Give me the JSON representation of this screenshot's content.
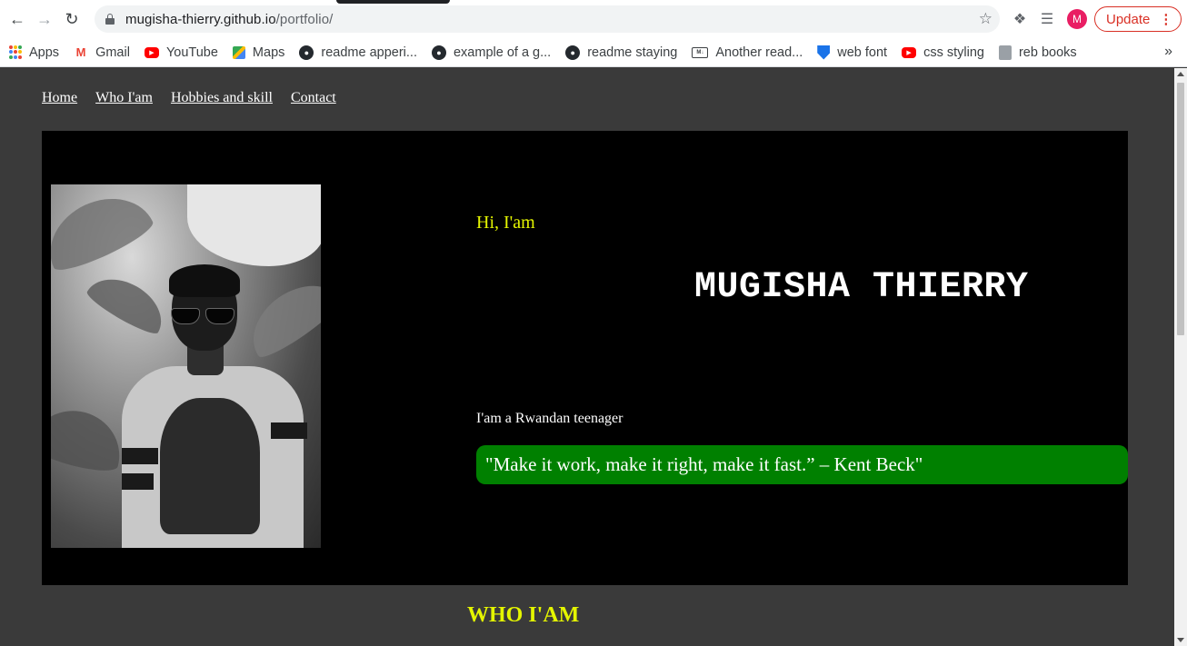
{
  "browser": {
    "url_host": "mugisha-thierry.github.io",
    "url_path": "/portfolio/",
    "profile_initial": "M",
    "update_label": "Update",
    "bookmarks": [
      {
        "label": "Apps",
        "icon": "apps-grid-icon"
      },
      {
        "label": "Gmail",
        "icon": "gmail-icon"
      },
      {
        "label": "YouTube",
        "icon": "youtube-icon"
      },
      {
        "label": "Maps",
        "icon": "maps-icon"
      },
      {
        "label": "readme apperi...",
        "icon": "github-icon"
      },
      {
        "label": "example of a g...",
        "icon": "github-icon"
      },
      {
        "label": "readme staying",
        "icon": "github-icon"
      },
      {
        "label": "Another read...",
        "icon": "markdown-icon"
      },
      {
        "label": "web font",
        "icon": "shield-icon"
      },
      {
        "label": "css styling",
        "icon": "youtube-icon"
      },
      {
        "label": "reb books",
        "icon": "book-icon"
      }
    ],
    "more_bookmarks": "»"
  },
  "site": {
    "nav": [
      "Home",
      "Who I'am",
      "Hobbies and skill",
      "Contact"
    ],
    "greeting": "Hi, I'am",
    "name": "MUGISHA THIERRY",
    "tagline": "I'am a Rwandan teenager",
    "quote": "\"Make it work, make it right, make it fast.” – Kent Beck\"",
    "section_heading": "WHO I'AM"
  },
  "colors": {
    "page_bg": "#3a3a3a",
    "hero_bg": "#000000",
    "accent_yellow": "#e4f500",
    "quote_green": "#008000",
    "update_red": "#d93025"
  }
}
